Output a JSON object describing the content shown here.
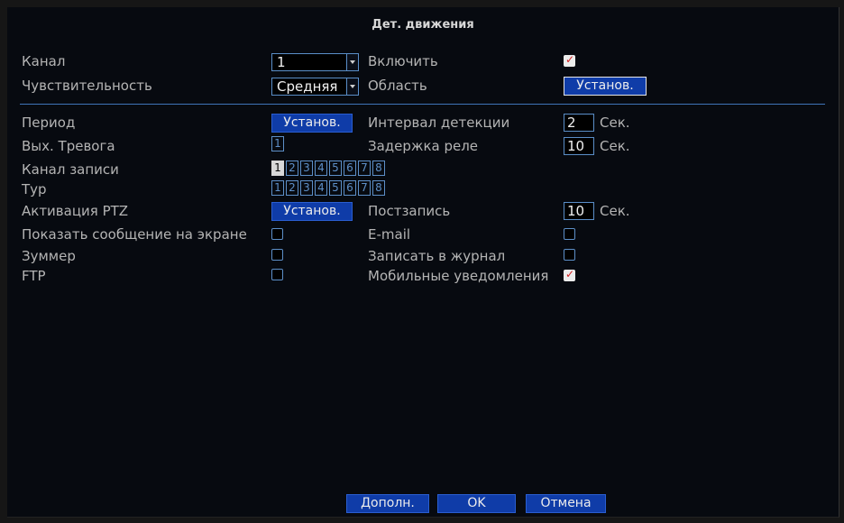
{
  "title": "Дет. движения",
  "labels": {
    "channel": "Канал",
    "enable": "Включить",
    "sensitivity": "Чувствительность",
    "region": "Область",
    "period": "Период",
    "interval": "Интервал детекции",
    "alarm_out": "Вых. Тревога",
    "relay_delay": "Задержка реле",
    "record_channel": "Канал записи",
    "tour": "Тур",
    "ptz": "Активация PTZ",
    "post_record": "Постзапись",
    "show_message": "Показать сообщение на экране",
    "email": "E-mail",
    "buzzer": "Зуммер",
    "write_log": "Записать в журнал",
    "ftp": "FTP",
    "mobile": "Мобильные уведомления"
  },
  "fields": {
    "channel_value": "1",
    "sensitivity_value": "Средняя",
    "interval_value": "2",
    "relay_delay_value": "10",
    "post_record_value": "10",
    "sec_unit": "Сек.",
    "alarm_out_box": "1"
  },
  "channels": [
    "1",
    "2",
    "3",
    "4",
    "5",
    "6",
    "7",
    "8"
  ],
  "buttons": {
    "set": "Установ.",
    "advanced": "Дополн.",
    "ok": "OK",
    "cancel": "Отмена"
  },
  "checkbox_states": {
    "enable": true,
    "show_message": false,
    "email": false,
    "buzzer": false,
    "write_log": false,
    "ftp": false,
    "mobile": true
  },
  "colors": {
    "background": "#070a10",
    "button": "#0f3ca8",
    "accent_border": "#5a8ec8",
    "text": "#b4b4b4"
  }
}
